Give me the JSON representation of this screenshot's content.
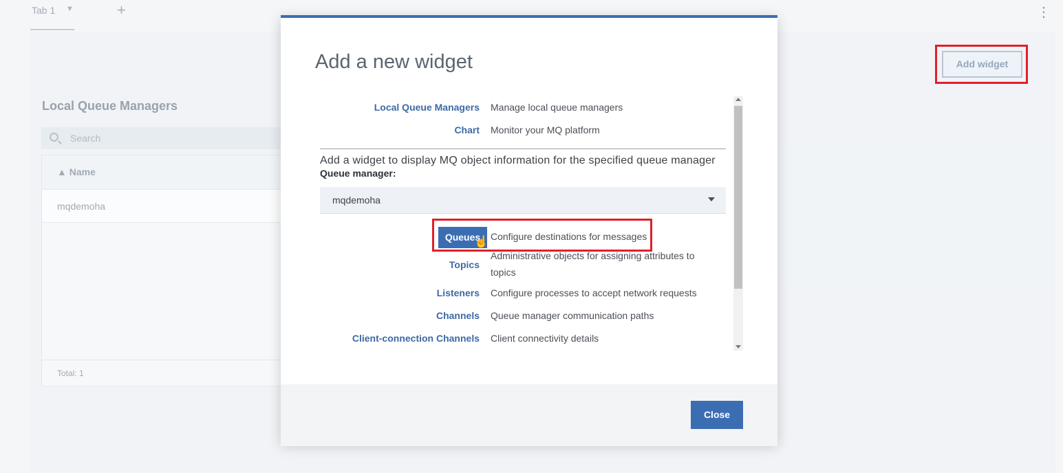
{
  "tabs": {
    "active_label": "Tab 1",
    "caret": "▼",
    "add": "+"
  },
  "kebab": "⋮",
  "add_widget_label": "Add widget",
  "lqm": {
    "title": "Local Queue Managers",
    "search_placeholder": "Search",
    "column_header": "▲  Name",
    "rows": [
      "mqdemoha"
    ],
    "footer": "Total: 1"
  },
  "modal": {
    "title": "Add a new widget",
    "widgets_top": [
      {
        "name": "Local Queue Managers",
        "desc": "Manage local queue managers"
      },
      {
        "name": "Chart",
        "desc": "Monitor your MQ platform"
      }
    ],
    "qm_hint": "Add a widget to display MQ object information for the specified queue manager",
    "qm_label": "Queue manager:",
    "qm_value": "mqdemoha",
    "widgets_qm": [
      {
        "name": "Queues",
        "desc": "Configure destinations for messages"
      },
      {
        "name": "Topics",
        "desc": "Administrative objects for assigning attributes to topics"
      },
      {
        "name": "Listeners",
        "desc": "Configure processes to accept network requests"
      },
      {
        "name": "Channels",
        "desc": "Queue manager communication paths"
      },
      {
        "name": "Client-connection Channels",
        "desc": "Client connectivity details"
      }
    ],
    "close_label": "Close"
  },
  "colors": {
    "accent": "#3b6db3",
    "highlight": "#e01f2a"
  }
}
